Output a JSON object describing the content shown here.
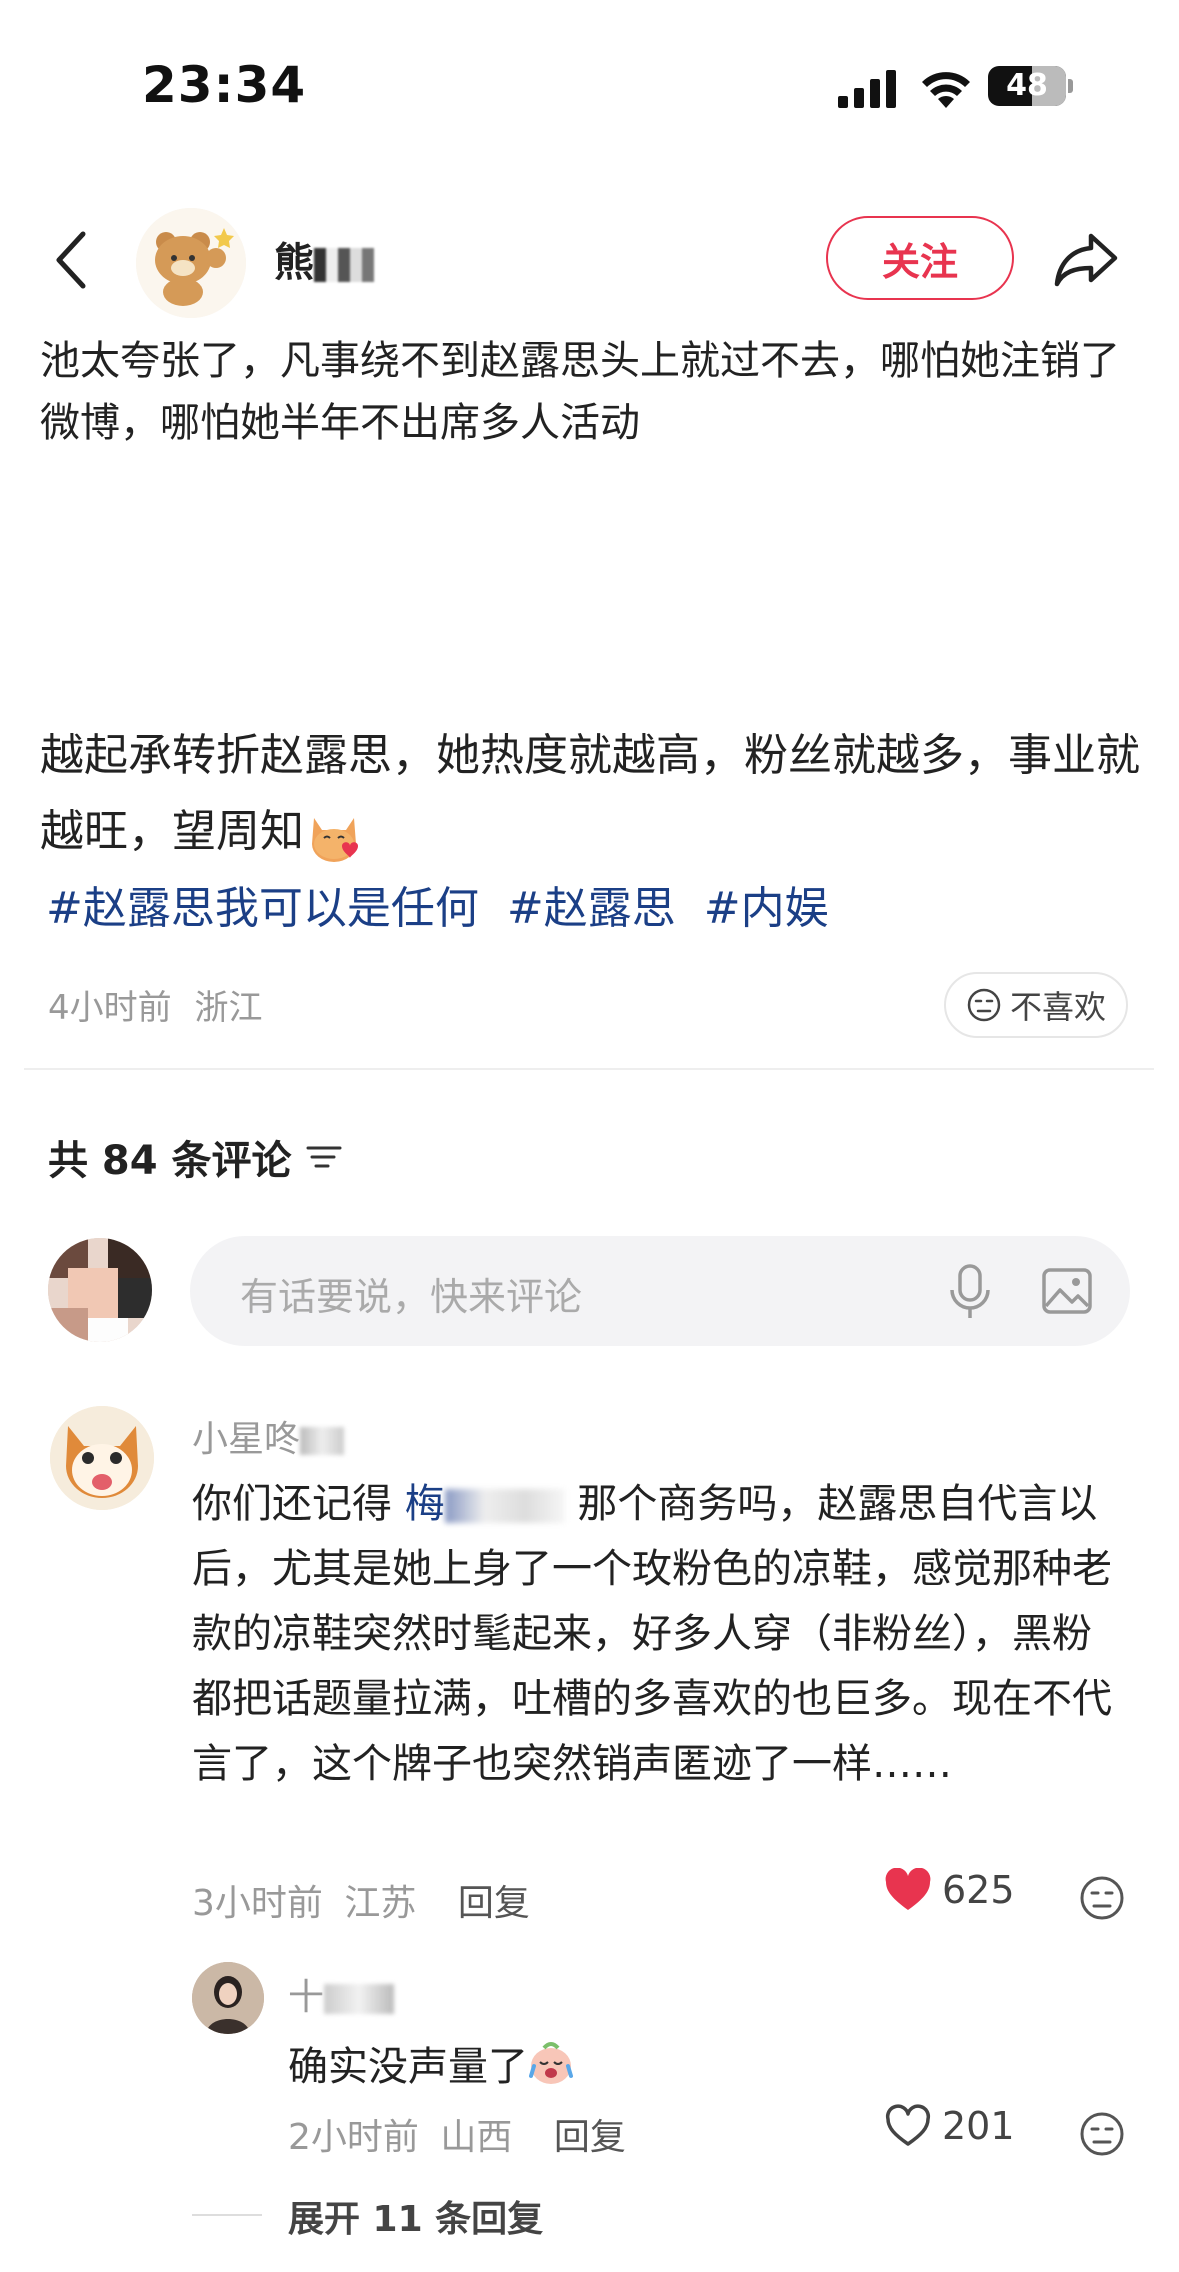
{
  "status": {
    "time": "23:34",
    "battery": "48"
  },
  "header": {
    "author_name": "熊",
    "follow_label": "关注"
  },
  "post": {
    "paragraph_1": "池太夸张了，凡事绕不到赵露思头上就过不去，哪怕她注销了微博，哪怕她半年不出席多人活动",
    "paragraph_2": "越起承转折赵露思，她热度就越高，粉丝就越多，事业就越旺，望周知",
    "hashtags": [
      "#赵露思我可以是任何",
      "#赵露思",
      "#内娱"
    ],
    "time": "4小时前",
    "location": "浙江",
    "dislike_label": "不喜欢"
  },
  "comments_section": {
    "count_label": "共 84 条评论",
    "input_placeholder": "有话要说，快来评论"
  },
  "comment_1": {
    "name": "小星咚",
    "text_before_link": "你们还记得 ",
    "link_text": "梅",
    "text_after_link": " 那个商务吗，赵露思自代言以后，尤其是她上身了一个玫粉色的凉鞋，感觉那种老款的凉鞋突然时髦起来，好多人穿（非粉丝），黑粉都把话题量拉满，吐槽的多喜欢的也巨多。现在不代言了，这个牌子也突然销声匿迹了一样……",
    "time": "3小时前",
    "location": "江苏",
    "reply_label": "回复",
    "likes": "625",
    "liked": true,
    "like_color": "#e8344f"
  },
  "reply_1": {
    "name": "十",
    "text": "确实没声量了",
    "time": "2小时前",
    "location": "山西",
    "reply_label": "回复",
    "likes": "201",
    "liked": false
  },
  "expand_label": "展开 11 条回复"
}
